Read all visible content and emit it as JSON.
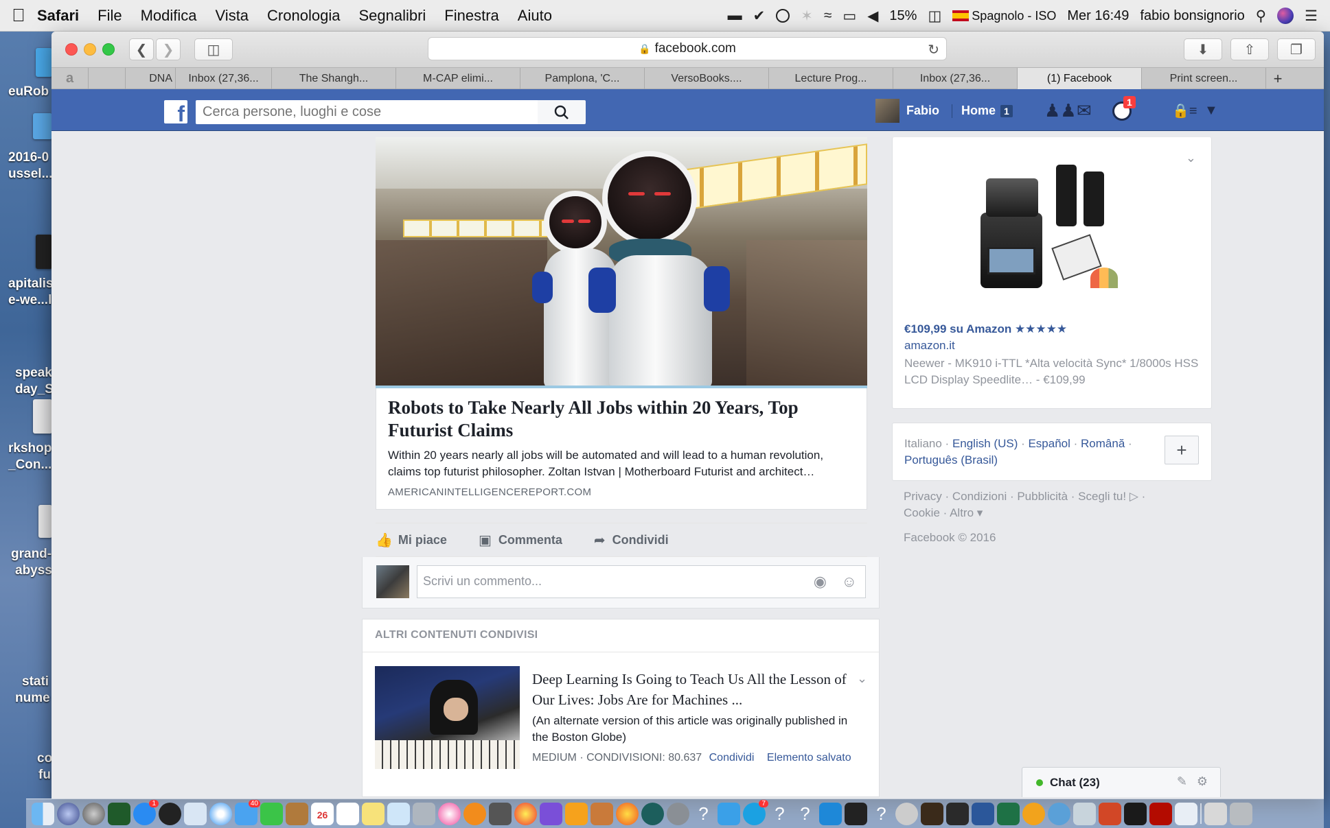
{
  "menubar": {
    "app": "Safari",
    "items": [
      "File",
      "Modifica",
      "Vista",
      "Cronologia",
      "Segnalibri",
      "Finestra",
      "Aiuto"
    ],
    "battery": "15%",
    "input_source": "Spagnolo - ISO",
    "flag_sub": "ISO",
    "datetime": "Mer 16:49",
    "user": "fabio bonsignorio"
  },
  "desktop": {
    "labels": [
      "euRob",
      "2016-0",
      "ussel...",
      "apitalis",
      "e-we...l",
      "speak",
      "day_S",
      "rkshop",
      "_Con...",
      "grand-",
      "abyss",
      "stati",
      "nume",
      "co",
      "fu"
    ]
  },
  "browser": {
    "url": "facebook.com",
    "tabs": [
      "DNA",
      "Inbox (27,36...",
      "The Shangh...",
      "M-CAP elimi...",
      "Pamplona, 'C...",
      "VersoBooks....",
      "Lecture Prog...",
      "Inbox (27,36...",
      "(1) Facebook",
      "Print screen..."
    ],
    "active_tab": "(1) Facebook",
    "amazon_glyph": "a"
  },
  "facebook": {
    "logo": "f",
    "search_placeholder": "Cerca persone, luoghi e cose",
    "profile_name": "Fabio",
    "home_label": "Home",
    "home_count": "1",
    "notif_count": "1"
  },
  "post": {
    "headline": "Robots to Take Nearly All Jobs within 20 Years, Top Futurist Claims",
    "description": "Within 20 years nearly all jobs will be automated and will lead to a human revolution, claims top futurist philosopher. Zoltan Istvan | Motherboard Futurist and architect…",
    "domain": "AMERICANINTELLIGENCEREPORT.COM",
    "like": "Mi piace",
    "comment": "Commenta",
    "share": "Condividi",
    "comment_placeholder": "Scrivi un commento..."
  },
  "altri": {
    "header": "ALTRI CONTENUTI CONDIVISI",
    "title": "Deep Learning Is Going to Teach Us All the Lesson of Our Lives: Jobs Are for Machines ...",
    "desc": "(An alternate version of this article was originally published in the Boston Globe)",
    "meta": "MEDIUM · CONDIVISIONI: 80.637",
    "share": "Condividi",
    "saved": "Elemento salvato"
  },
  "ad": {
    "price": "€109,99 su Amazon ★★★★★",
    "site": "amazon.it",
    "text": "Neewer - MK910 i-TTL *Alta velocità Sync* 1/8000s HSS LCD Display Speedlite… - €109,99"
  },
  "languages": {
    "current": "Italiano",
    "others": [
      "English (US)",
      "Español",
      "Română",
      "Português (Brasil)"
    ],
    "plus": "+"
  },
  "footer": {
    "links": [
      "Privacy",
      "Condizioni",
      "Pubblicità",
      "Scegli tu!"
    ],
    "links2": [
      "Cookie",
      "Altro ▾"
    ],
    "copyright": "Facebook © 2016"
  },
  "chat": {
    "label": "Chat (23)"
  },
  "dock": {
    "calendar_day": "26",
    "badge_mail": "40",
    "badge_appstore": "1",
    "badge_skype": "7"
  }
}
